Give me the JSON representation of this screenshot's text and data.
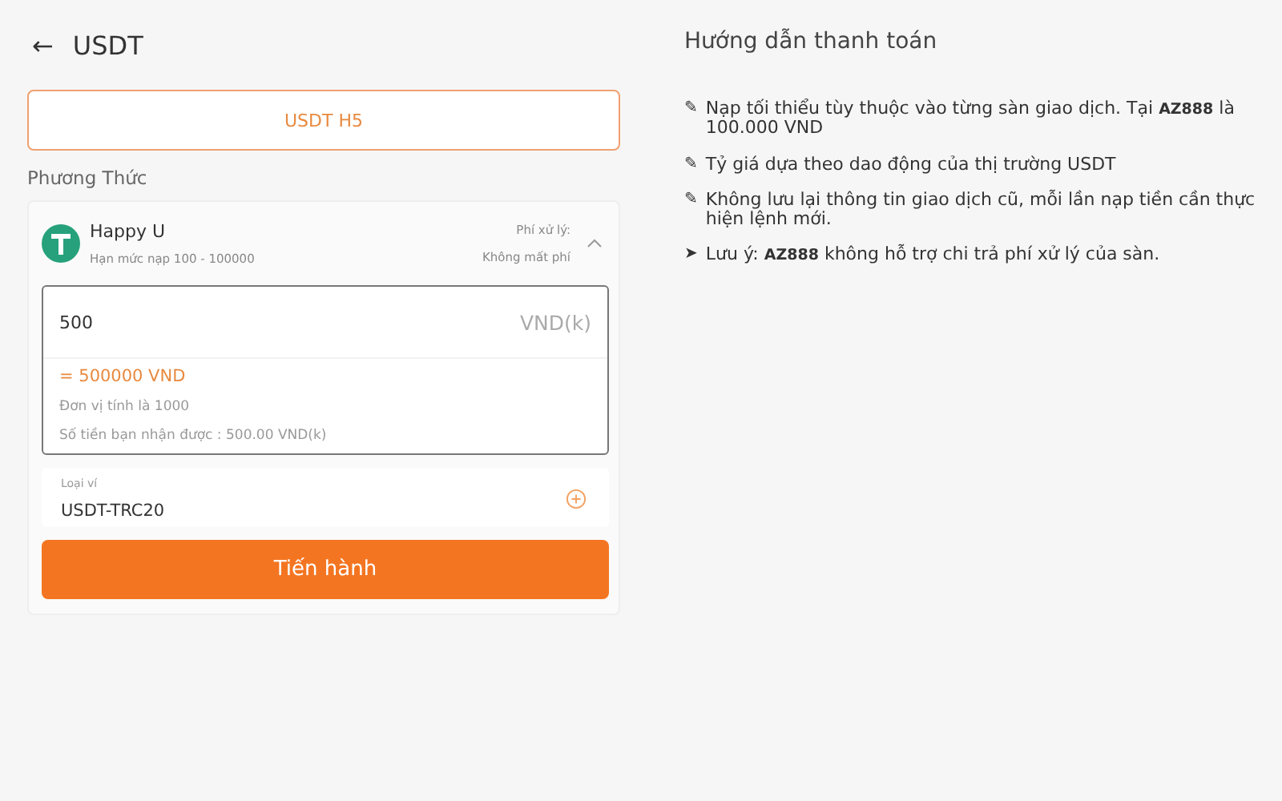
{
  "header": {
    "back": "←",
    "title": "USDT"
  },
  "channel_tab": {
    "label": "USDT H5",
    "selected": true
  },
  "method_label": "Phương Thức",
  "method": {
    "name": "Happy U",
    "limit": "Hạn mức nạp 100 - 100000",
    "fee_label": "Phí xử lý:",
    "fee_value": "Không mất phí",
    "expanded": true
  },
  "amount": {
    "value": "500",
    "unit": "VND(k)",
    "converted": "= 500000 VND",
    "unit_note": "Đơn vị tính là 1000",
    "received": "Số tiền bạn nhận được : 500.00 VND(k)"
  },
  "wallet": {
    "label": "Loại ví",
    "value": "USDT-TRC20"
  },
  "submit": "Tiến hành",
  "guide": {
    "title": "Hướng dẫn thanh toán",
    "notes": [
      {
        "marker": "✎",
        "text": "Nạp tối thiểu tùy thuộc vào từng sàn giao dịch. Tại **AZ888** là 100.000 VND"
      },
      {
        "marker": "✎",
        "text": "Tỷ giá dựa theo dao động của thị trường USDT"
      },
      {
        "marker": "✎",
        "text": "Không lưu lại thông tin giao dịch cũ, mỗi lần nạp tiền cần thực hiện lệnh mới."
      },
      {
        "marker": "➤",
        "text": "Lưu ý: **AZ888** không hỗ trợ chi trả phí xử lý của sàn."
      }
    ]
  }
}
